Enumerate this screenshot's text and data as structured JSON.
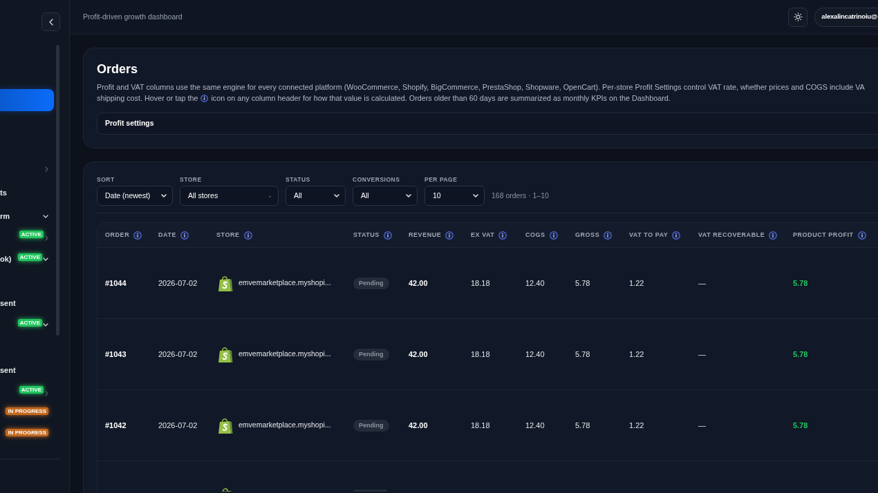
{
  "sidebar": {
    "items": [
      {
        "selected": true
      },
      {
        "selected": false,
        "expanded": false
      },
      {
        "selected": false,
        "label": "ts"
      },
      {
        "selected": false,
        "label": "rm",
        "expanded": true
      },
      {
        "selected": false,
        "badge": {
          "text": "ACTIVE",
          "color": "#22c55e"
        },
        "expanded": false
      },
      {
        "selected": false,
        "label": "ok)",
        "badge": {
          "text": "ACTIVE",
          "color": "#22c55e"
        },
        "expanded": true
      },
      {
        "selected": false,
        "label": "sent"
      },
      {
        "selected": false,
        "badge": {
          "text": "ACTIVE",
          "color": "#22c55e"
        },
        "expanded": true
      },
      {
        "selected": false,
        "label": "sent"
      },
      {
        "selected": false,
        "badge": {
          "text": "ACTIVE",
          "color": "#22c55e"
        },
        "expanded": false
      },
      {
        "selected": false,
        "badge": {
          "text": "IN PROGRESS",
          "color": "#c2691f"
        }
      },
      {
        "selected": false,
        "badge": {
          "text": "IN PROGRESS",
          "color": "#c2691f"
        }
      }
    ]
  },
  "header": {
    "title": "Profit-driven growth dashboard",
    "user": "alexalincatrinoiu@"
  },
  "orders": {
    "title": "Orders",
    "description": [
      "Profit and VAT columns use the same engine for every connected platform (WooCommerce, Shopify, BigCommerce, PrestaShop, Shopware, OpenCart). Per-store Profit Settings control VAT rate, whether prices and COGS include VA",
      "shipping cost. Hover or tap the",
      "icon on any column header for how that value is calculated. Orders older than 60 days are summarized as monthly KPIs on the Dashboard."
    ],
    "settings_label": "Profit settings"
  },
  "filters": {
    "items": [
      {
        "label": "SORT",
        "value": "Date (newest)",
        "kind": "select"
      },
      {
        "label": "STORE",
        "value": "All stores",
        "kind": "combobox"
      },
      {
        "label": "STATUS",
        "value": "All",
        "kind": "select"
      },
      {
        "label": "CONVERSIONS",
        "value": "All",
        "kind": "select"
      },
      {
        "label": "PER PAGE",
        "value": "10",
        "kind": "select"
      }
    ],
    "result_count": "168 orders · 1–10"
  },
  "table": {
    "columns": [
      {
        "label": "ORDER",
        "kind": "id"
      },
      {
        "label": "DATE",
        "kind": "text"
      },
      {
        "label": "STORE",
        "kind": "store"
      },
      {
        "label": "STATUS",
        "kind": "status"
      },
      {
        "label": "REVENUE",
        "kind": "amount"
      },
      {
        "label": "EX VAT",
        "kind": "text"
      },
      {
        "label": "COGS",
        "kind": "text"
      },
      {
        "label": "GROSS",
        "kind": "text"
      },
      {
        "label": "VAT TO PAY",
        "kind": "text"
      },
      {
        "label": "VAT RECOVERABLE",
        "kind": "text"
      },
      {
        "label": "PRODUCT PROFIT",
        "kind": "profit"
      }
    ],
    "rows": [
      {
        "cells": [
          "#1044",
          "2026-07-02",
          "emvemarketplace.myshopi...",
          "Pending",
          "42.00",
          "18.18",
          "12.40",
          "5.78",
          "1.22",
          "—",
          "5.78"
        ]
      },
      {
        "cells": [
          "#1043",
          "2026-07-02",
          "emvemarketplace.myshopi...",
          "Pending",
          "42.00",
          "18.18",
          "12.40",
          "5.78",
          "1.22",
          "—",
          "5.78"
        ]
      },
      {
        "cells": [
          "#1042",
          "2026-07-02",
          "emvemarketplace.myshopi...",
          "Pending",
          "42.00",
          "18.18",
          "12.40",
          "5.78",
          "1.22",
          "—",
          "5.78"
        ]
      }
    ],
    "next_row_peek": true
  }
}
